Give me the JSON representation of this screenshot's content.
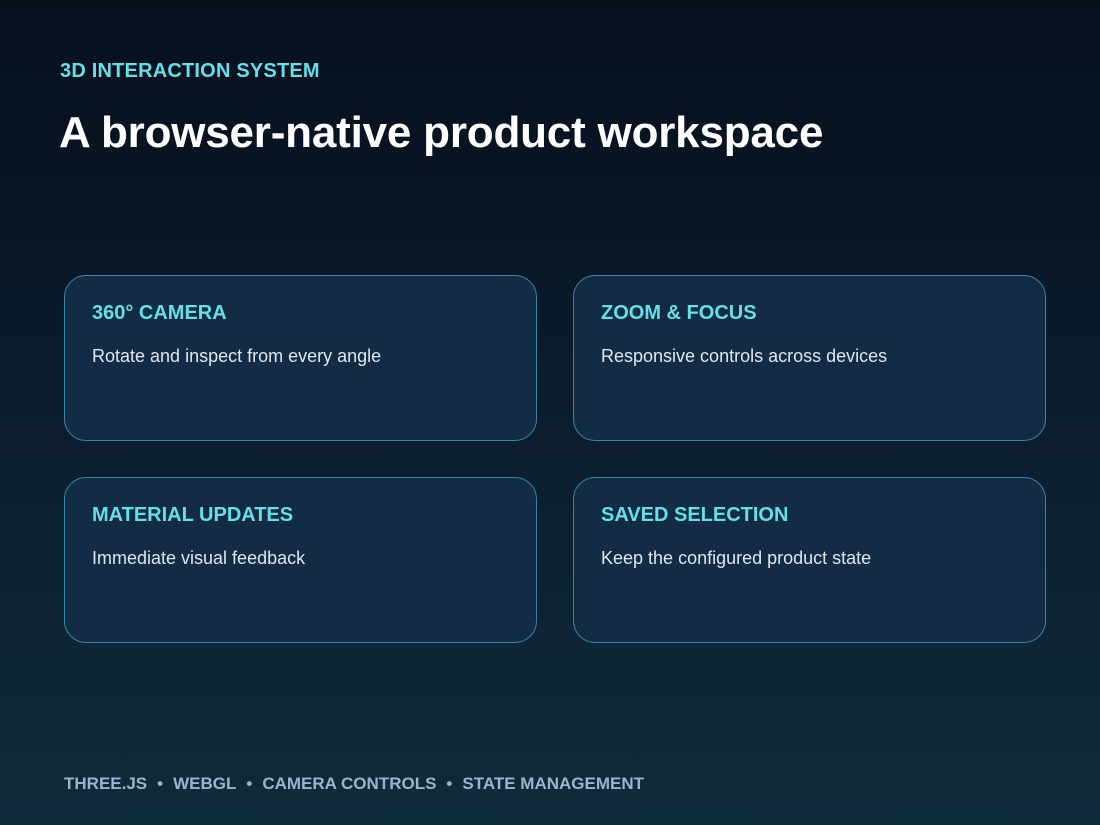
{
  "header": {
    "eyebrow": "3D INTERACTION SYSTEM",
    "title": "A browser-native product workspace"
  },
  "features": [
    {
      "title": "360° CAMERA",
      "description": "Rotate and inspect from every angle"
    },
    {
      "title": "ZOOM & FOCUS",
      "description": "Responsive controls across devices"
    },
    {
      "title": "MATERIAL UPDATES",
      "description": "Immediate visual feedback"
    },
    {
      "title": "SAVED SELECTION",
      "description": "Keep the configured product state"
    }
  ],
  "footer": {
    "separator": "•",
    "tags": [
      "THREE.JS",
      "WEBGL",
      "CAMERA CONTROLS",
      "STATE MANAGEMENT"
    ]
  },
  "colors": {
    "accent": "#67dfe8",
    "card_background": "#122c45",
    "card_border": "#3a86a8",
    "footer_text": "#9cb4d2"
  }
}
